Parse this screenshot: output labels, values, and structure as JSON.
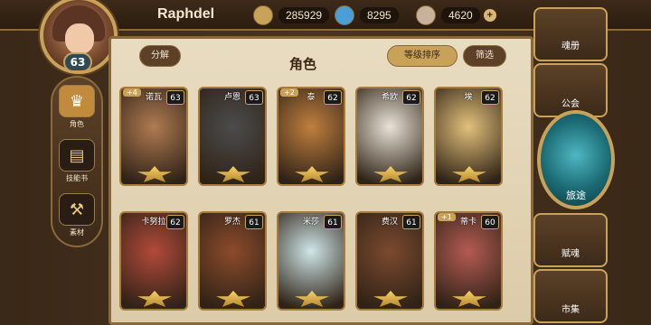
{
  "player": {
    "name": "Raphdel",
    "level": "63"
  },
  "resources": [
    {
      "id": "gold",
      "value": "285929",
      "icon": "gold-coin-icon",
      "color": "#c9a25a"
    },
    {
      "id": "gem",
      "value": "8295",
      "icon": "blue-crystal-icon",
      "color": "#4aa0d6"
    },
    {
      "id": "ore",
      "value": "4620",
      "icon": "stone-ore-icon",
      "color": "#c8b39a"
    }
  ],
  "panel": {
    "title": "角色",
    "decompose_label": "分解",
    "sort_label": "等级排序",
    "filter_label": "筛选"
  },
  "sidebar": [
    {
      "label": "角色",
      "icon": "character-icon",
      "active": true
    },
    {
      "label": "技能书",
      "icon": "skill-book-icon",
      "active": false
    },
    {
      "label": "素材",
      "icon": "material-icon",
      "active": false
    }
  ],
  "right_menu": {
    "top": "魂册",
    "guild": "公会",
    "journey": "旅途",
    "soul": "赋魂",
    "market": "市集"
  },
  "cards": [
    {
      "name": "诺瓦",
      "level": "63",
      "badge": "+4",
      "tone": "#b07b52"
    },
    {
      "name": "卢恩",
      "level": "63",
      "badge": "",
      "tone": "#4c4c4c"
    },
    {
      "name": "泰",
      "level": "62",
      "badge": "+2",
      "tone": "#c07f3f"
    },
    {
      "name": "希欧",
      "level": "62",
      "badge": "",
      "tone": "#e9e2d6"
    },
    {
      "name": "埃",
      "level": "62",
      "badge": "",
      "tone": "#e2c17c"
    },
    {
      "name": "卡努拉",
      "level": "62",
      "badge": "",
      "tone": "#b24a3a"
    },
    {
      "name": "罗杰",
      "level": "61",
      "badge": "",
      "tone": "#8c4b2c"
    },
    {
      "name": "米莎",
      "level": "61",
      "badge": "",
      "tone": "#cfe6e8"
    },
    {
      "name": "费汉",
      "level": "61",
      "badge": "",
      "tone": "#7b4a2f"
    },
    {
      "name": "蒂卡",
      "level": "60",
      "badge": "+1",
      "tone": "#b45b53"
    }
  ]
}
